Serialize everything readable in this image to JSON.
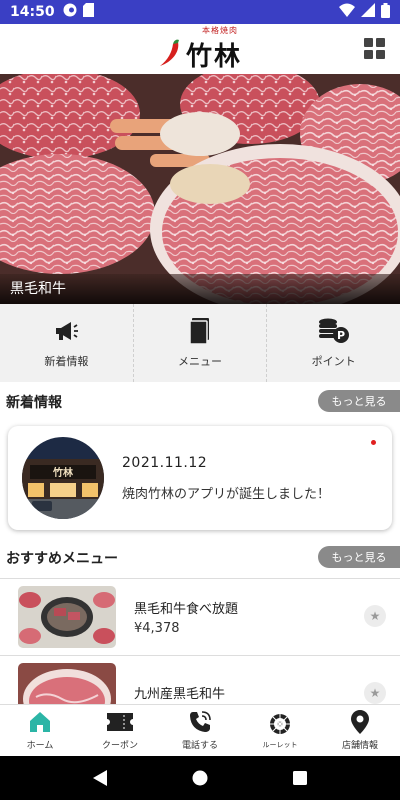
{
  "status_bar": {
    "time": "14:50"
  },
  "header": {
    "logo_sub": "本格焼肉",
    "logo_main": "竹林"
  },
  "hero": {
    "caption": "黒毛和牛"
  },
  "quick_menu": [
    {
      "label": "新着情報",
      "icon": "megaphone-icon"
    },
    {
      "label": "メニュー",
      "icon": "book-icon"
    },
    {
      "label": "ポイント",
      "icon": "coins-points-icon"
    }
  ],
  "news": {
    "title": "新着情報",
    "more": "もっと見る",
    "date": "2021.11.12",
    "text": "焼肉竹林のアプリが誕生しました！"
  },
  "recommend": {
    "title": "おすすめメニュー",
    "more": "もっと見る",
    "items": [
      {
        "name": "黒毛和牛食べ放題",
        "price": "¥4,378"
      },
      {
        "name": "九州産黒毛和牛",
        "price": ""
      }
    ]
  },
  "bottom_nav": [
    {
      "label": "ホーム",
      "icon": "home-icon",
      "active": true
    },
    {
      "label": "クーポン",
      "icon": "ticket-icon"
    },
    {
      "label": "電話する",
      "icon": "phone-icon"
    },
    {
      "label": "ルーレット",
      "icon": "roulette-icon"
    },
    {
      "label": "店舗情報",
      "icon": "location-pin-icon"
    }
  ],
  "colors": {
    "status_bar": "#3a3fc4",
    "accent": "#2bb5a6",
    "more_button": "#8a8a8a",
    "new_dot": "#e02020"
  }
}
